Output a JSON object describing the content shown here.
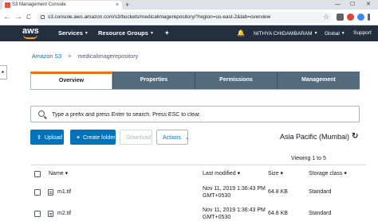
{
  "browser": {
    "tab_title": "S3 Management Console",
    "tab_close": "×",
    "new_tab": "+",
    "min": "—",
    "max": "☐",
    "close": "✕",
    "back": "←",
    "forward": "→",
    "reload": "C",
    "url": "s3.console.aws.amazon.com/s3/buckets/medicalimagerepository/?region=us-east-2&tab=overview",
    "star": "☆"
  },
  "aws_nav": {
    "logo_text": "aws",
    "services": "Services",
    "resource_groups": "Resource Groups",
    "pin_icon": "✦",
    "bell_icon": "🔔",
    "user": "NITHYA CHIDAMBARAM",
    "region": "Global",
    "support": "Support",
    "caret": "▼"
  },
  "breadcrumb": {
    "root": "Amazon S3",
    "separator": ">",
    "bucket": "medicalimagerepository"
  },
  "side_toggle": "▸",
  "tabs": [
    "Overview",
    "Properties",
    "Permissions",
    "Management"
  ],
  "search": {
    "placeholder": "Type a prefix and press Enter to search. Press ESC to clear."
  },
  "actions_bar": {
    "upload": "Upload",
    "upload_icon": "⇧",
    "create_folder": "Create folder",
    "create_folder_icon": "+",
    "download": "Download",
    "actions": "Actions",
    "actions_caret": "⌄",
    "region": "Asia Pacific (Mumbai)",
    "refresh_icon": "↻"
  },
  "table": {
    "viewing": "Viewing 1 to 5",
    "columns": [
      "Name ▾",
      "Last modified ▾",
      "Size ▾",
      "Storage class ▾"
    ],
    "rows": [
      {
        "name": "m1.tif",
        "modified_1": "Nov 11, 2019 1:36:43 PM",
        "modified_2": "GMT+0530",
        "size": "64.8 KB",
        "storage": "Standard"
      },
      {
        "name": "m2.tif",
        "modified_1": "Nov 11, 2019 1:36:43 PM",
        "modified_2": "GMT+0530",
        "size": "64.8 KB",
        "storage": "Standard"
      }
    ]
  },
  "colors": {
    "aws_nav_bg": "#232f3e",
    "aws_orange": "#ff9900",
    "tab_inactive": "#546b7e",
    "tab_active_border": "#ec7211",
    "primary_blue": "#0073bb"
  }
}
